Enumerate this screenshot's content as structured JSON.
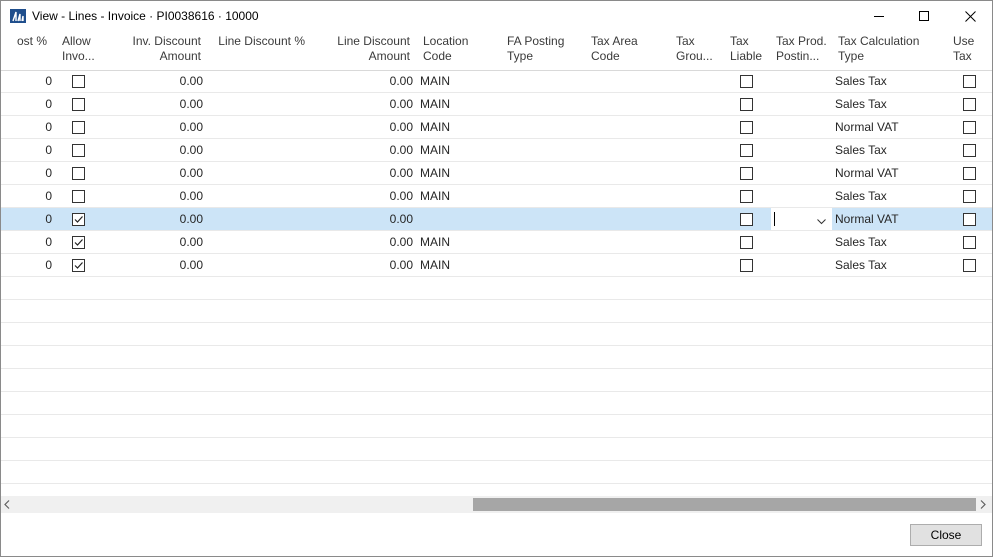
{
  "window": {
    "title": "View - Lines - Invoice · PI0038616 · 10000"
  },
  "columns": {
    "cost_pct": "ost %",
    "allow_inv_1": "Allow",
    "allow_inv_2": "Invo...",
    "inv_disc_1": "Inv. Discount",
    "inv_disc_2": "Amount",
    "line_disc_pct": "Line Discount %",
    "line_disc_amt_1": "Line Discount",
    "line_disc_amt_2": "Amount",
    "location_1": "Location",
    "location_2": "Code",
    "fa_posting_1": "FA Posting",
    "fa_posting_2": "Type",
    "tax_area_1": "Tax Area",
    "tax_area_2": "Code",
    "tax_group_1": "Tax",
    "tax_group_2": "Grou...",
    "tax_liable_1": "Tax",
    "tax_liable_2": "Liable",
    "tax_prod_1": "Tax Prod.",
    "tax_prod_2": "Postin...",
    "tax_calc_1": "Tax Calculation",
    "tax_calc_2": "Type",
    "use_tax_1": "Use",
    "use_tax_2": "Tax"
  },
  "rows": [
    {
      "cost": "0",
      "allow": false,
      "inv_disc": "0.00",
      "line_disc_amt": "0.00",
      "location": "MAIN",
      "tax_liable": false,
      "tax_calc": "Sales Tax",
      "use_tax": false
    },
    {
      "cost": "0",
      "allow": false,
      "inv_disc": "0.00",
      "line_disc_amt": "0.00",
      "location": "MAIN",
      "tax_liable": false,
      "tax_calc": "Sales Tax",
      "use_tax": false
    },
    {
      "cost": "0",
      "allow": false,
      "inv_disc": "0.00",
      "line_disc_amt": "0.00",
      "location": "MAIN",
      "tax_liable": false,
      "tax_calc": "Normal VAT",
      "use_tax": false
    },
    {
      "cost": "0",
      "allow": false,
      "inv_disc": "0.00",
      "line_disc_amt": "0.00",
      "location": "MAIN",
      "tax_liable": false,
      "tax_calc": "Sales Tax",
      "use_tax": false
    },
    {
      "cost": "0",
      "allow": false,
      "inv_disc": "0.00",
      "line_disc_amt": "0.00",
      "location": "MAIN",
      "tax_liable": false,
      "tax_calc": "Normal VAT",
      "use_tax": false
    },
    {
      "cost": "0",
      "allow": false,
      "inv_disc": "0.00",
      "line_disc_amt": "0.00",
      "location": "MAIN",
      "tax_liable": false,
      "tax_calc": "Sales Tax",
      "use_tax": false
    },
    {
      "cost": "0",
      "allow": true,
      "inv_disc": "0.00",
      "line_disc_amt": "0.00",
      "location": "",
      "tax_liable": false,
      "tax_calc": "Normal VAT",
      "use_tax": false,
      "selected": true
    },
    {
      "cost": "0",
      "allow": true,
      "inv_disc": "0.00",
      "line_disc_amt": "0.00",
      "location": "MAIN",
      "tax_liable": false,
      "tax_calc": "Sales Tax",
      "use_tax": false
    },
    {
      "cost": "0",
      "allow": true,
      "inv_disc": "0.00",
      "line_disc_amt": "0.00",
      "location": "MAIN",
      "tax_liable": false,
      "tax_calc": "Sales Tax",
      "use_tax": false
    }
  ],
  "empty_rows": 9,
  "actions": {
    "close_label": "Close"
  },
  "colors": {
    "selection": "#cce4f7",
    "scroll_thumb": "#a6a6a6",
    "button_bg": "#e1e1e1"
  }
}
